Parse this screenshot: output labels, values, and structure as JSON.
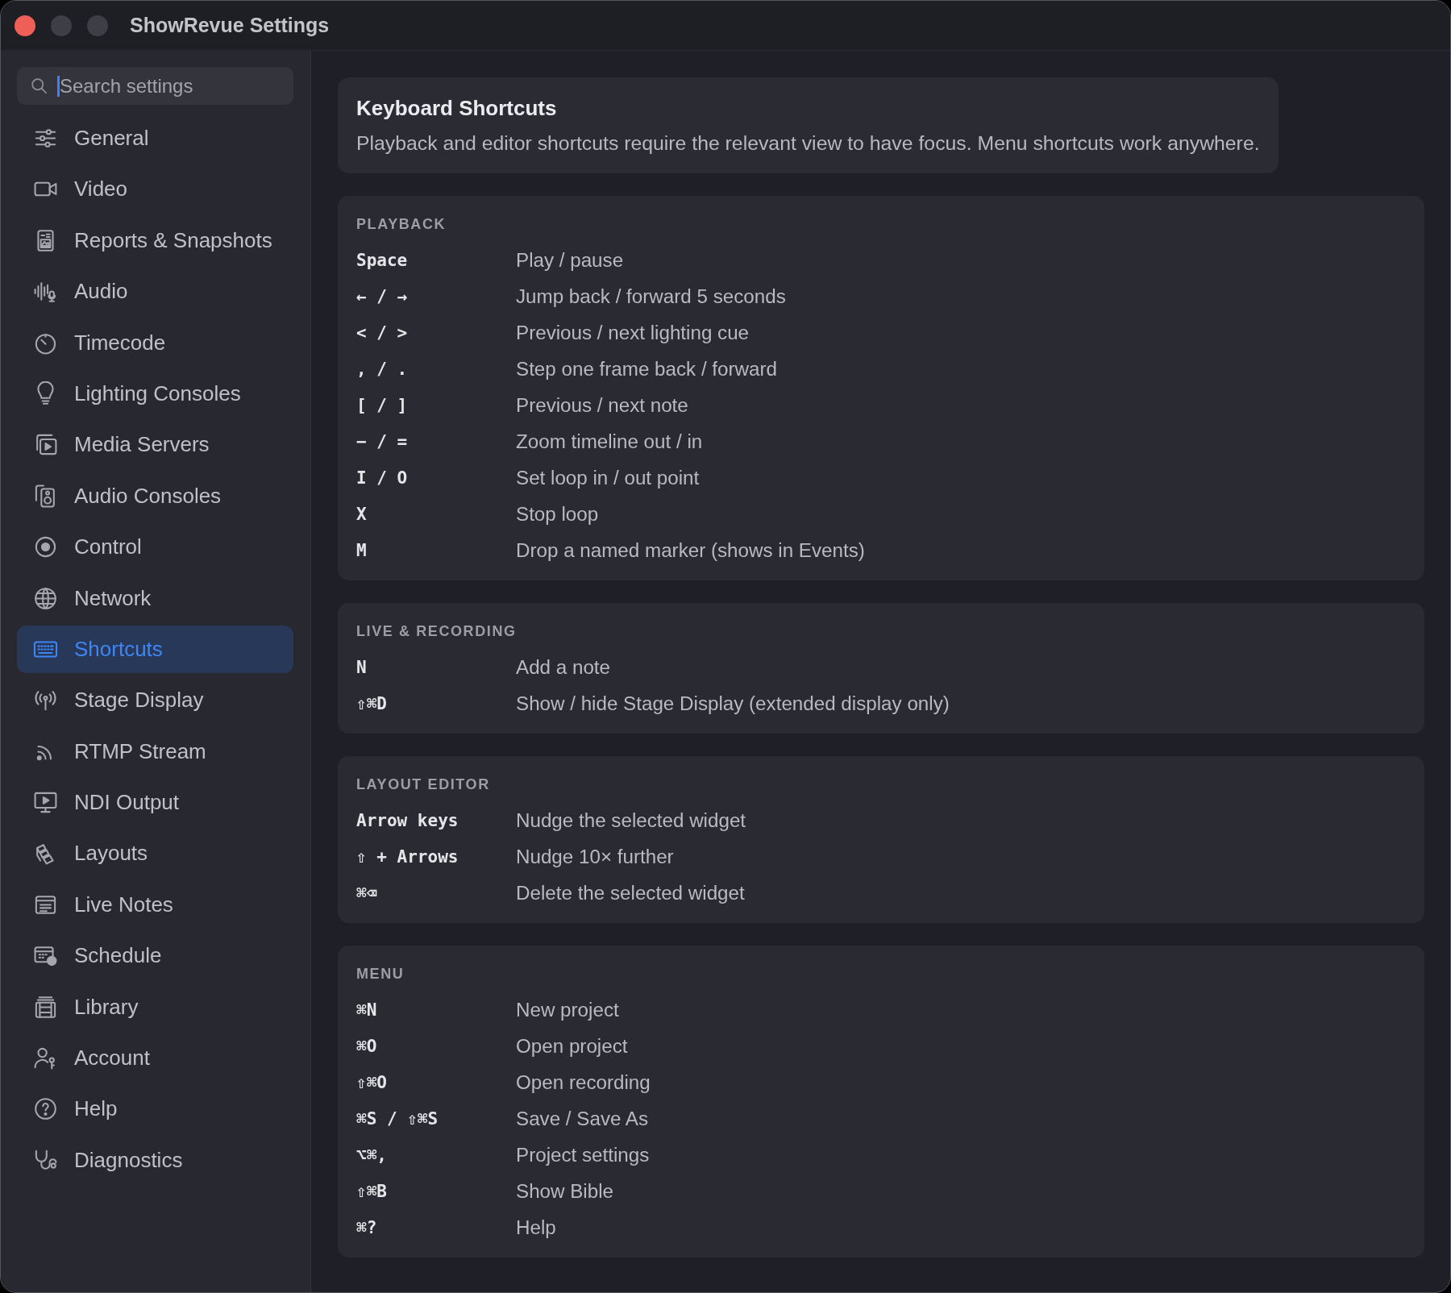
{
  "window": {
    "title": "ShowRevue Settings"
  },
  "window_controls": [
    {
      "disabled": false
    },
    {
      "disabled": true
    },
    {
      "disabled": true
    }
  ],
  "sidebar": {
    "search": {
      "placeholder": "Search settings"
    },
    "items": [
      {
        "label": "General",
        "selected": false
      },
      {
        "label": "Video",
        "selected": false
      },
      {
        "label": "Reports & Snapshots",
        "selected": false
      },
      {
        "label": "Audio",
        "selected": false
      },
      {
        "label": "Timecode",
        "selected": false
      },
      {
        "label": "Lighting Consoles",
        "selected": false
      },
      {
        "label": "Media Servers",
        "selected": false
      },
      {
        "label": "Audio Consoles",
        "selected": false
      },
      {
        "label": "Control",
        "selected": false
      },
      {
        "label": "Network",
        "selected": false
      },
      {
        "label": "Shortcuts",
        "selected": true
      },
      {
        "label": "Stage Display",
        "selected": false
      },
      {
        "label": "RTMP Stream",
        "selected": false
      },
      {
        "label": "NDI Output",
        "selected": false
      },
      {
        "label": "Layouts",
        "selected": false
      },
      {
        "label": "Live Notes",
        "selected": false
      },
      {
        "label": "Schedule",
        "selected": false
      },
      {
        "label": "Library",
        "selected": false
      },
      {
        "label": "Account",
        "selected": false
      },
      {
        "label": "Help",
        "selected": false
      },
      {
        "label": "Diagnostics",
        "selected": false
      }
    ]
  },
  "header": {
    "title": "Keyboard Shortcuts",
    "description": "Playback and editor shortcuts require the relevant view to have focus. Menu shortcuts work anywhere."
  },
  "sections": [
    {
      "heading": "PLAYBACK",
      "rows": [
        {
          "keys": "Space",
          "action": "Play / pause"
        },
        {
          "keys": "← / →",
          "action": "Jump back / forward 5 seconds"
        },
        {
          "keys": "< / >",
          "action": "Previous / next lighting cue"
        },
        {
          "keys": ", / .",
          "action": "Step one frame back / forward"
        },
        {
          "keys": "[ / ]",
          "action": "Previous / next note"
        },
        {
          "keys": "− / =",
          "action": "Zoom timeline out / in"
        },
        {
          "keys": "I / O",
          "action": "Set loop in / out point"
        },
        {
          "keys": "X",
          "action": "Stop loop"
        },
        {
          "keys": "M",
          "action": "Drop a named marker (shows in Events)"
        }
      ]
    },
    {
      "heading": "LIVE & RECORDING",
      "rows": [
        {
          "keys": "N",
          "action": "Add a note"
        },
        {
          "keys": "⇧⌘D",
          "action": "Show / hide Stage Display (extended display only)"
        }
      ]
    },
    {
      "heading": "LAYOUT EDITOR",
      "rows": [
        {
          "keys": "Arrow keys",
          "action": "Nudge the selected widget"
        },
        {
          "keys": "⇧ + Arrows",
          "action": "Nudge 10× further"
        },
        {
          "keys": "⌘⌫",
          "action": "Delete the selected widget"
        }
      ]
    },
    {
      "heading": "MENU",
      "rows": [
        {
          "keys": "⌘N",
          "action": "New project"
        },
        {
          "keys": "⌘O",
          "action": "Open project"
        },
        {
          "keys": "⇧⌘O",
          "action": "Open recording"
        },
        {
          "keys": "⌘S / ⇧⌘S",
          "action": "Save / Save As"
        },
        {
          "keys": "⌥⌘,",
          "action": "Project settings"
        },
        {
          "keys": "⇧⌘B",
          "action": "Show Bible"
        },
        {
          "keys": "⌘?",
          "action": "Help"
        }
      ]
    }
  ]
}
